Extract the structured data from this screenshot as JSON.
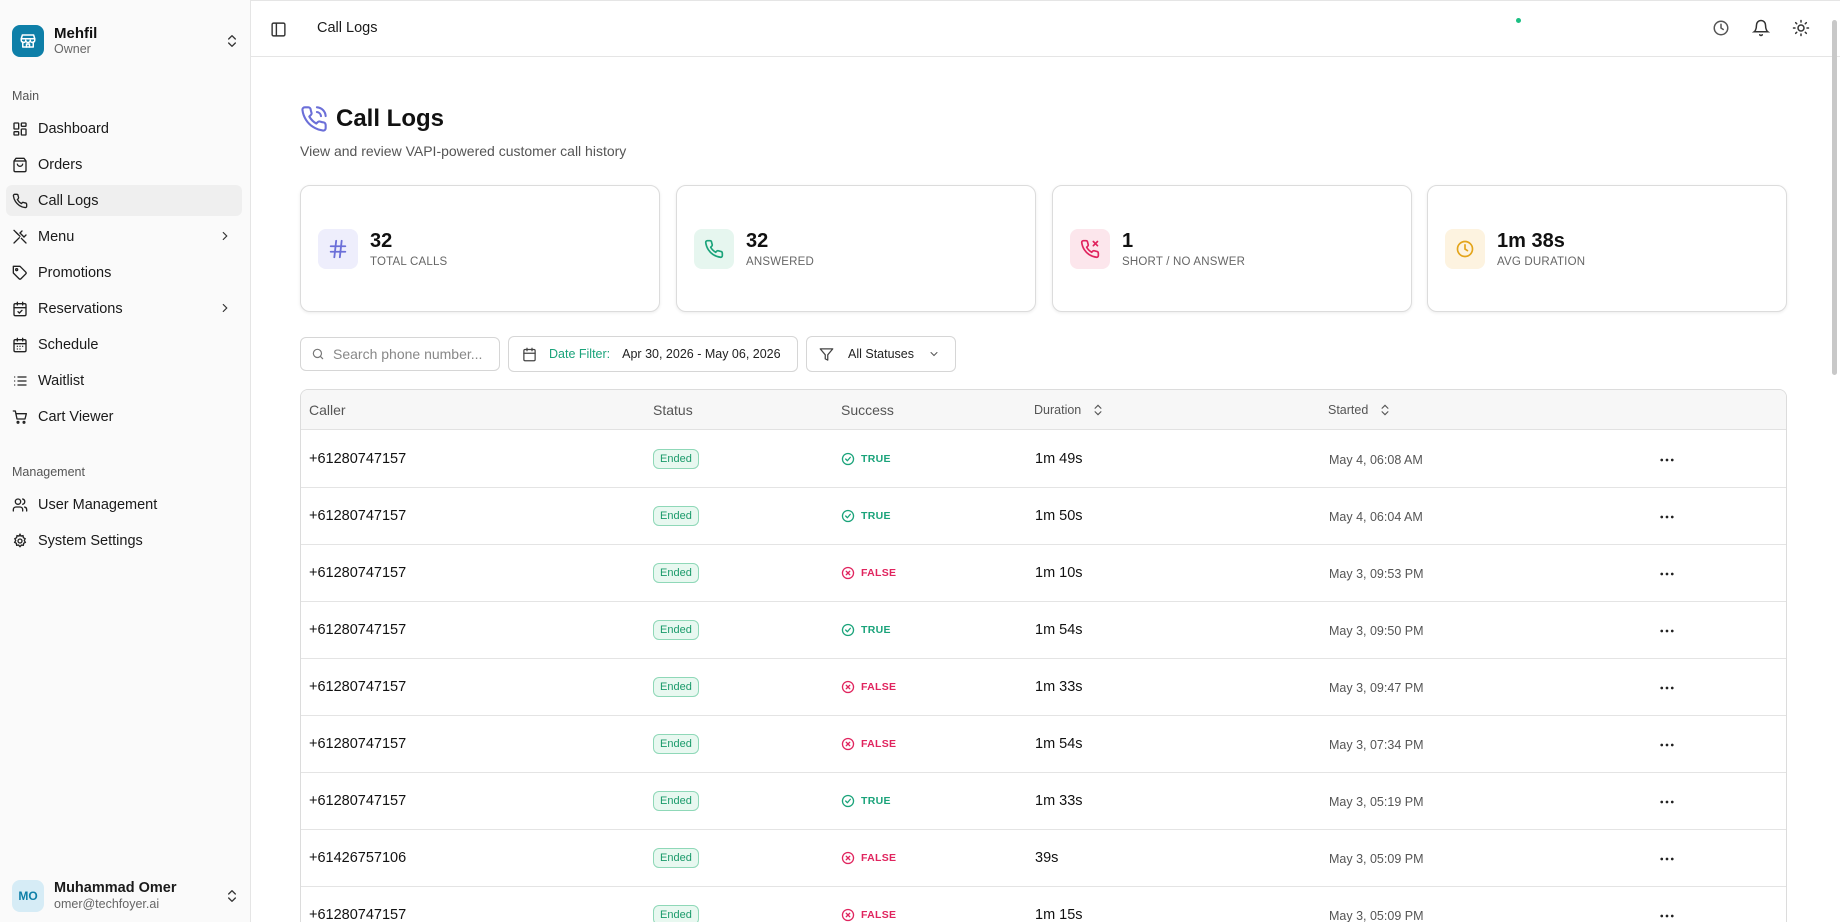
{
  "sidebar": {
    "brand_name": "Mehfil",
    "brand_role": "Owner",
    "main_label": "Main",
    "main_items": [
      {
        "label": "Dashboard",
        "icon": "dashboard-icon"
      },
      {
        "label": "Orders",
        "icon": "shopping-bag-icon"
      },
      {
        "label": "Call Logs",
        "icon": "phone-icon",
        "active": true
      },
      {
        "label": "Menu",
        "icon": "utensils-icon",
        "has_submenu": true
      },
      {
        "label": "Promotions",
        "icon": "tag-icon"
      },
      {
        "label": "Reservations",
        "icon": "calendar-check-icon",
        "has_submenu": true
      },
      {
        "label": "Schedule",
        "icon": "calendar-icon"
      },
      {
        "label": "Waitlist",
        "icon": "list-icon"
      },
      {
        "label": "Cart Viewer",
        "icon": "cart-icon"
      }
    ],
    "management_label": "Management",
    "management_items": [
      {
        "label": "User Management",
        "icon": "users-icon"
      },
      {
        "label": "System Settings",
        "icon": "gear-icon"
      }
    ],
    "user": {
      "initials": "MO",
      "name": "Muhammad Omer",
      "email": "omer@techfoyer.ai"
    }
  },
  "header": {
    "breadcrumb": "Call Logs"
  },
  "page": {
    "title": "Call Logs",
    "subtitle": "View and review VAPI-powered customer call history"
  },
  "stats": [
    {
      "value": "32",
      "label": "TOTAL CALLS",
      "icon": "hash-icon",
      "color": "#6b6fd8",
      "bg": "#eeeefc"
    },
    {
      "value": "32",
      "label": "ANSWERED",
      "icon": "phone-icon",
      "color": "#1aa37a",
      "bg": "#e6f6ef"
    },
    {
      "value": "1",
      "label": "SHORT / NO ANSWER",
      "icon": "phone-missed-icon",
      "color": "#e0245e",
      "bg": "#fce6ec"
    },
    {
      "value": "1m 38s",
      "label": "AVG DURATION",
      "icon": "clock-icon",
      "color": "#e3a41a",
      "bg": "#fdf3e0"
    }
  ],
  "filters": {
    "search_placeholder": "Search phone number...",
    "date_label": "Date Filter:",
    "date_range": "Apr 30, 2026 - May 06, 2026",
    "status_value": "All Statuses"
  },
  "table": {
    "columns": {
      "caller": "Caller",
      "status": "Status",
      "success": "Success",
      "duration": "Duration",
      "started": "Started"
    },
    "rows": [
      {
        "caller": "+61280747157",
        "status": "Ended",
        "success": "TRUE",
        "duration": "1m 49s",
        "started": "May 4, 06:08 AM"
      },
      {
        "caller": "+61280747157",
        "status": "Ended",
        "success": "TRUE",
        "duration": "1m 50s",
        "started": "May 4, 06:04 AM"
      },
      {
        "caller": "+61280747157",
        "status": "Ended",
        "success": "FALSE",
        "duration": "1m 10s",
        "started": "May 3, 09:53 PM"
      },
      {
        "caller": "+61280747157",
        "status": "Ended",
        "success": "TRUE",
        "duration": "1m 54s",
        "started": "May 3, 09:50 PM"
      },
      {
        "caller": "+61280747157",
        "status": "Ended",
        "success": "FALSE",
        "duration": "1m 33s",
        "started": "May 3, 09:47 PM"
      },
      {
        "caller": "+61280747157",
        "status": "Ended",
        "success": "FALSE",
        "duration": "1m 54s",
        "started": "May 3, 07:34 PM"
      },
      {
        "caller": "+61280747157",
        "status": "Ended",
        "success": "TRUE",
        "duration": "1m 33s",
        "started": "May 3, 05:19 PM"
      },
      {
        "caller": "+61426757106",
        "status": "Ended",
        "success": "FALSE",
        "duration": "39s",
        "started": "May 3, 05:09 PM"
      },
      {
        "caller": "+61280747157",
        "status": "Ended",
        "success": "FALSE",
        "duration": "1m 15s",
        "started": "May 3, 05:09 PM"
      }
    ]
  },
  "colors": {
    "accent": "#0e7fa8",
    "success": "#1aa37a",
    "danger": "#e0245e"
  }
}
